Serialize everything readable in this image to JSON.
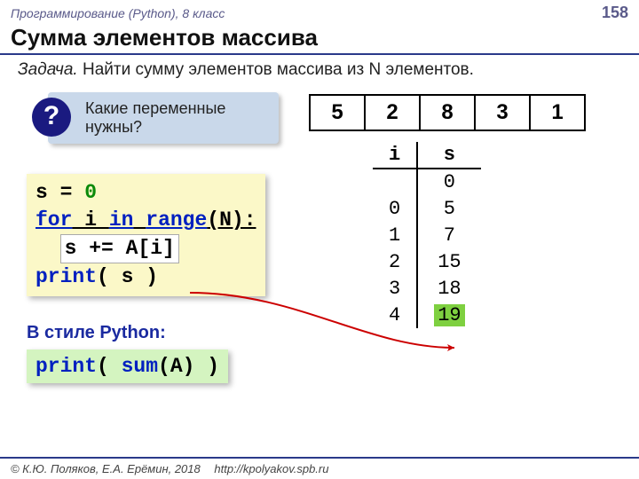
{
  "header": {
    "subject": "Программирование (Python), 8 класс",
    "page": "158"
  },
  "title": "Сумма элементов массива",
  "task": {
    "label": "Задача.",
    "text": "Найти сумму элементов массива из N элементов."
  },
  "callout": {
    "mark": "?",
    "text": "Какие переменные нужны?"
  },
  "array": [
    "5",
    "2",
    "8",
    "3",
    "1"
  ],
  "code": {
    "l1a": "s = ",
    "l1b": "0",
    "l2a": "for",
    "l2b": " i ",
    "l2c": "in",
    "l2d": " ",
    "l2e": "range",
    "l2f": "(N):",
    "l3pad": "  ",
    "l3": "s += A[i]",
    "l4a": "print",
    "l4b": "( s )"
  },
  "pystyle_label": "В стиле Python:",
  "code2": {
    "a": "print",
    "b": "( ",
    "c": "sum",
    "d": "(A) )"
  },
  "trace": {
    "headers": [
      "i",
      "s"
    ],
    "rows": [
      [
        "",
        "0"
      ],
      [
        "0",
        "5"
      ],
      [
        "1",
        "7"
      ],
      [
        "2",
        "15"
      ],
      [
        "3",
        "18"
      ],
      [
        "4",
        "19"
      ]
    ]
  },
  "footer": {
    "copyright": "© К.Ю. Поляков, Е.А. Ерёмин, 2018",
    "url": "http://kpolyakov.spb.ru"
  }
}
